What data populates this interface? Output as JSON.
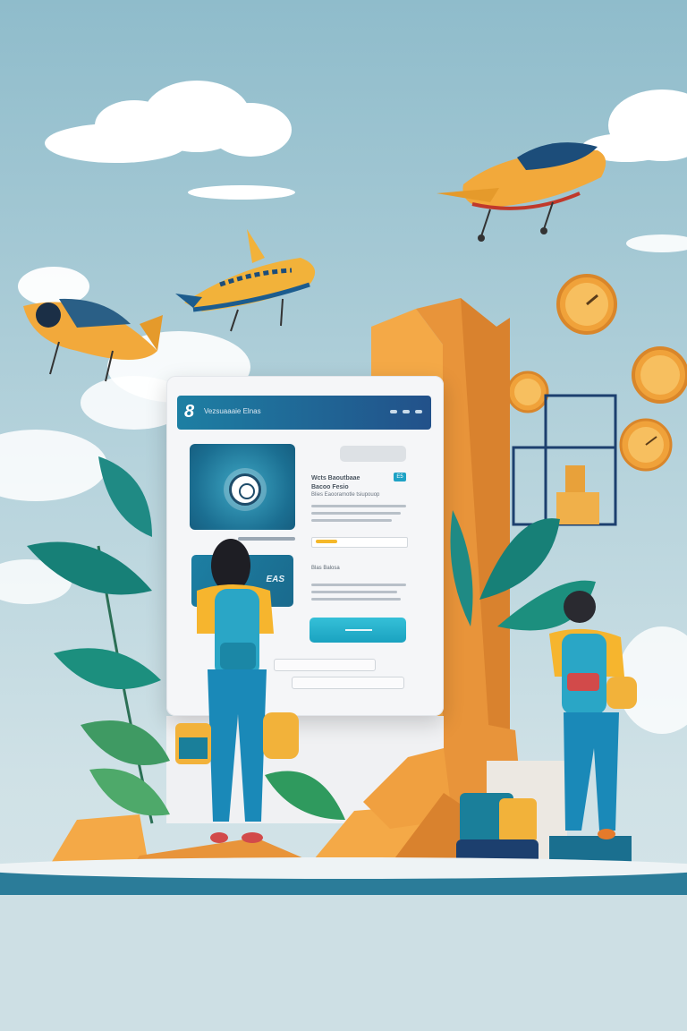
{
  "screen": {
    "logo": "8",
    "brand": "Vezsuaaaie Elnas",
    "heading_line1": "Wcts Baoutbaae",
    "heading_line2": "Bacoo Fesio",
    "subheading": "Blies Eaooramotle tsiupouop",
    "badge": "E5",
    "promo_text": "EAS",
    "mini_label": "Blas Balosa"
  },
  "colors": {
    "sky": "#8fbccb",
    "accent_teal": "#1ea2c5",
    "accent_orange": "#f0a23a",
    "header_blue": "#1d7fa3"
  }
}
